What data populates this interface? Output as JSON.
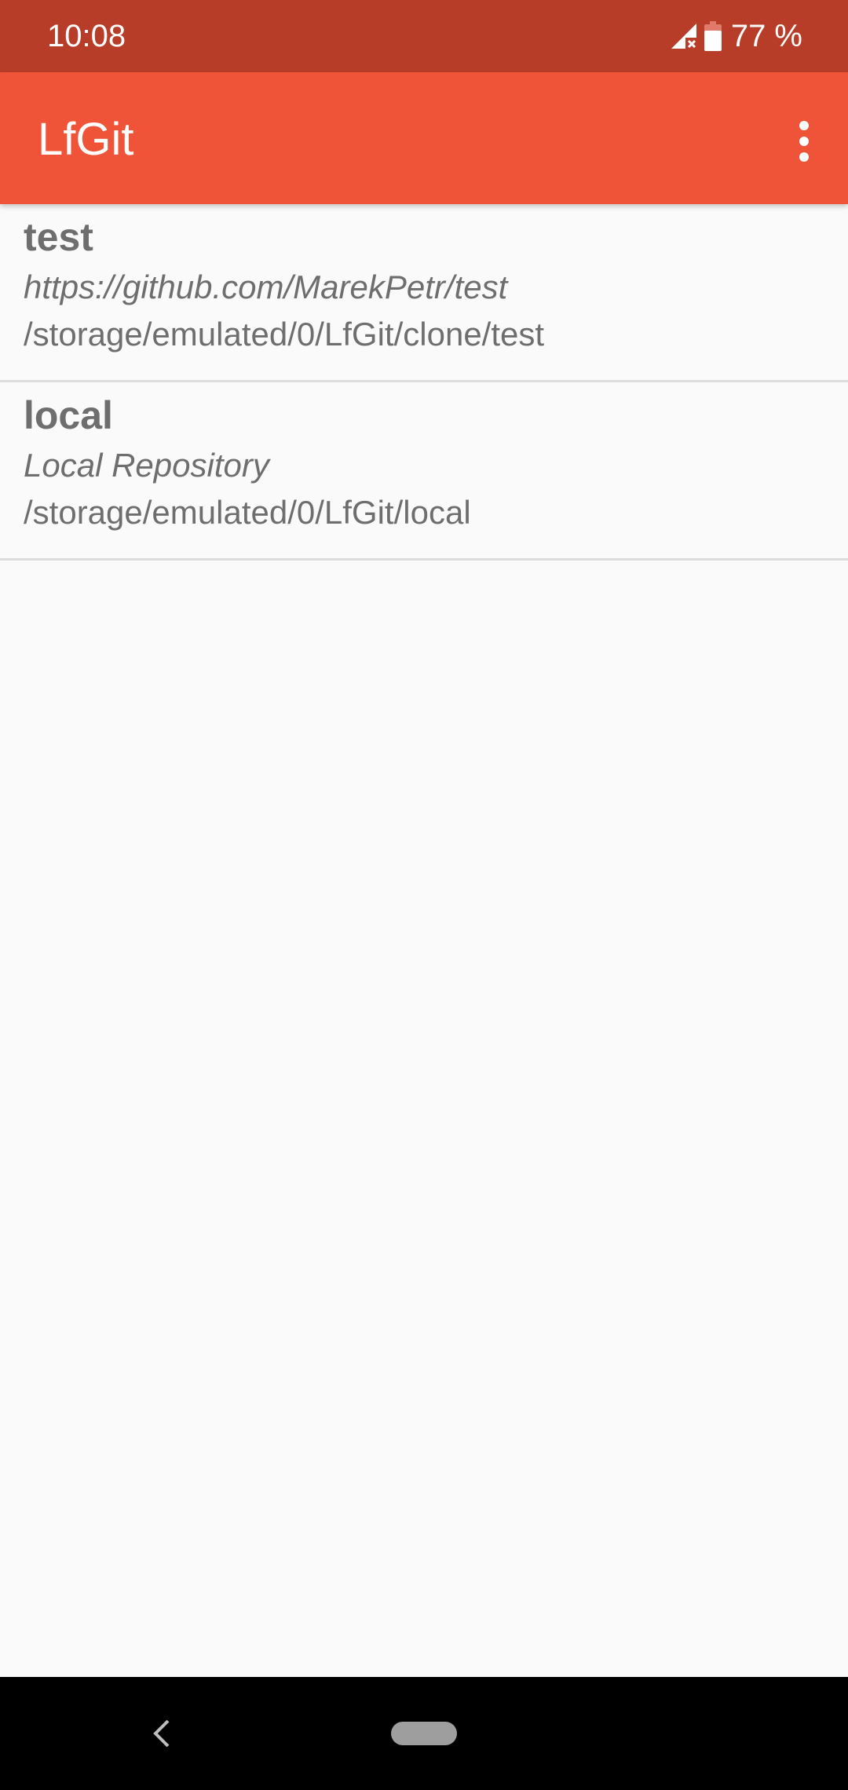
{
  "status_bar": {
    "time": "10:08",
    "battery": "77 %",
    "icons": [
      "signal-icon",
      "battery-icon"
    ]
  },
  "app_bar": {
    "title": "LfGit",
    "menu_icon": "more-vert-icon"
  },
  "repositories": [
    {
      "name": "test",
      "remote": "https://github.com/MarekPetr/test",
      "path": "/storage/emulated/0/LfGit/clone/test"
    },
    {
      "name": "local",
      "remote": "Local Repository",
      "path": "/storage/emulated/0/LfGit/local"
    }
  ],
  "nav_bar": {
    "icons": [
      "back-icon",
      "home-pill-icon"
    ]
  },
  "colors": {
    "status_bar": "#b73d28",
    "app_bar": "#f05438",
    "background": "#fafafa",
    "text": "#6e6e6e",
    "divider": "#dcdcdc"
  }
}
